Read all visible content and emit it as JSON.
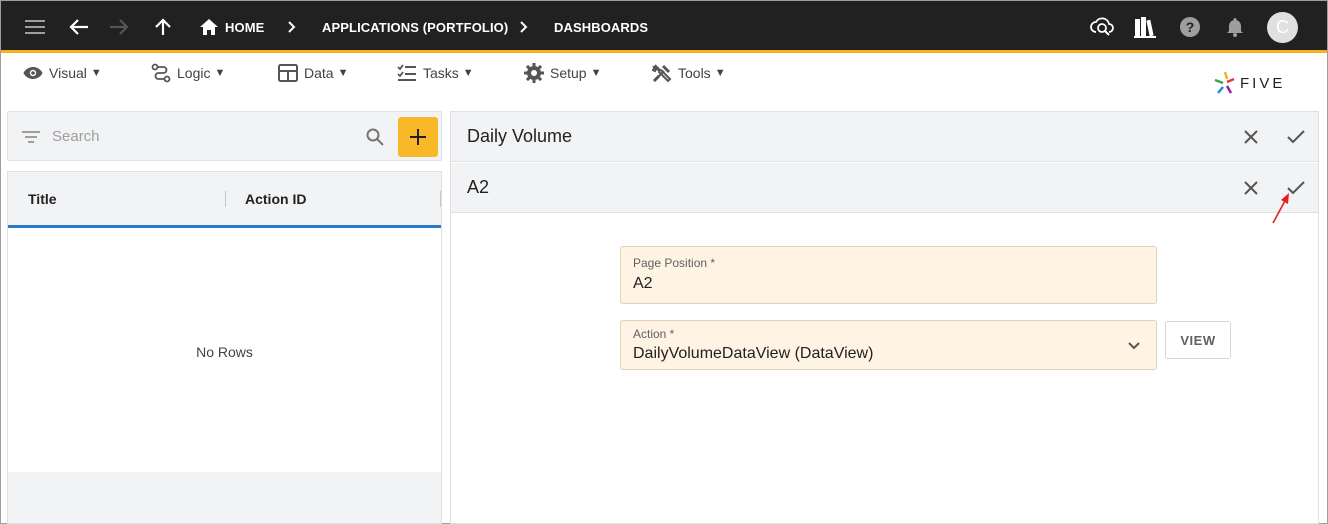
{
  "topbar": {
    "breadcrumbs": [
      {
        "label": "HOME"
      },
      {
        "label": "APPLICATIONS (PORTFOLIO)"
      },
      {
        "label": "DASHBOARDS"
      }
    ],
    "avatar_initial": "C",
    "accent_color": "#f4b21d"
  },
  "menu": {
    "items": [
      {
        "label": "Visual",
        "icon": "eye-icon"
      },
      {
        "label": "Logic",
        "icon": "logic-icon"
      },
      {
        "label": "Data",
        "icon": "table-icon"
      },
      {
        "label": "Tasks",
        "icon": "tasks-icon"
      },
      {
        "label": "Setup",
        "icon": "gear-icon"
      },
      {
        "label": "Tools",
        "icon": "tools-icon"
      }
    ],
    "caret": "▼"
  },
  "logo": {
    "text": "FIVE"
  },
  "list": {
    "search_placeholder": "Search",
    "columns": [
      "Title",
      "Action ID"
    ],
    "empty_text": "No Rows"
  },
  "parent_form": {
    "title": "Daily Volume"
  },
  "child_form": {
    "title": "A2",
    "fields": {
      "page_position": {
        "label": "Page Position *",
        "value": "A2"
      },
      "action": {
        "label": "Action *",
        "value": "DailyVolumeDataView (DataView)"
      }
    },
    "view_button": "VIEW"
  }
}
